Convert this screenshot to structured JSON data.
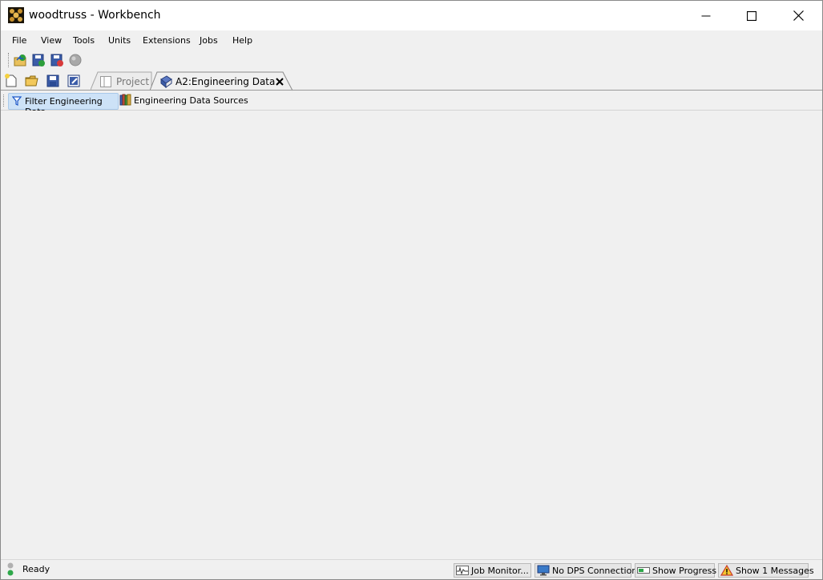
{
  "window": {
    "title": "woodtruss - Workbench"
  },
  "menu": {
    "items": [
      {
        "label": "File"
      },
      {
        "label": "View"
      },
      {
        "label": "Tools"
      },
      {
        "label": "Units"
      },
      {
        "label": "Extensions"
      },
      {
        "label": "Jobs"
      },
      {
        "label": "Help"
      }
    ]
  },
  "tabs": {
    "project_label": "Project",
    "active_label": "A2:Engineering Data"
  },
  "subtoolbar": {
    "filter_label": "Filter Engineering Data",
    "sources_label": "Engineering Data Sources"
  },
  "status": {
    "text": "Ready",
    "job_monitor": "Job Monitor...",
    "dps": "No DPS Connection",
    "progress": "Show Progress",
    "messages": "Show 1 Messages"
  }
}
